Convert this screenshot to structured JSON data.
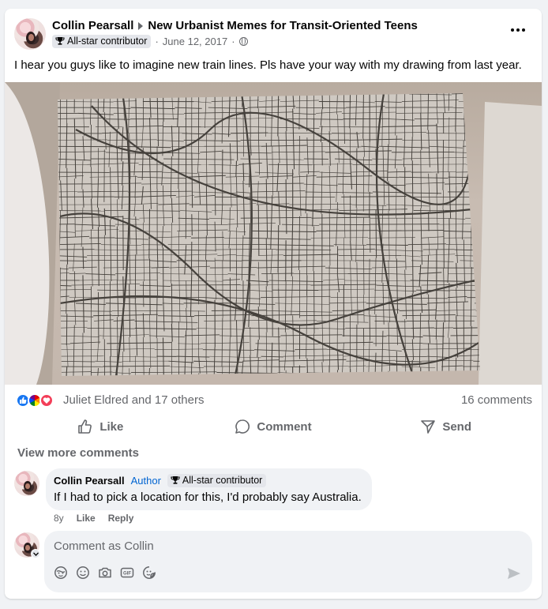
{
  "post": {
    "author": "Collin Pearsall",
    "group": "New Urbanist Memes for Transit-Oriented Teens",
    "badge": "All-star contributor",
    "date": "June 12, 2017",
    "separator": "·",
    "text": "I hear you guys like to imagine new train lines. Pls have your way with my drawing from last year."
  },
  "reactions": {
    "icons": [
      "like-icon",
      "pride-icon",
      "love-icon"
    ],
    "names": "Juliet Eldred and 17 others",
    "comments": "16 comments"
  },
  "actions": {
    "like": "Like",
    "comment": "Comment",
    "send": "Send"
  },
  "comments": {
    "view_more": "View more comments",
    "items": [
      {
        "name": "Collin Pearsall",
        "author_tag": "Author",
        "badge": "All-star contributor",
        "text": "If I had to pick a location for this, I'd probably say Australia.",
        "age": "8y",
        "like": "Like",
        "reply": "Reply"
      }
    ]
  },
  "composer": {
    "placeholder": "Comment as Collin"
  },
  "colors": {
    "accent": "#1877f2",
    "secondary_text": "#65676b",
    "author_tag": "#0064d1",
    "love": "#f33e58"
  }
}
